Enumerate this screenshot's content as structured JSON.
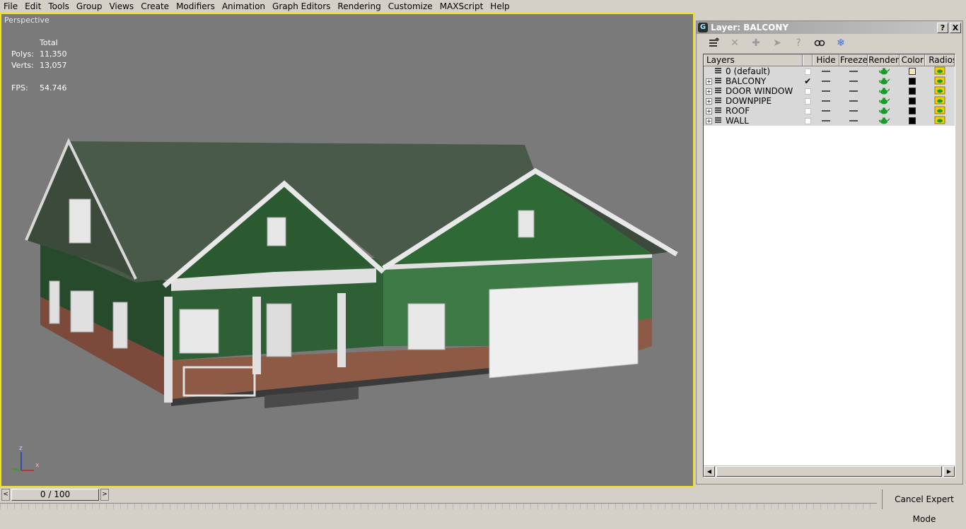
{
  "menu": [
    "File",
    "Edit",
    "Tools",
    "Group",
    "Views",
    "Create",
    "Modifiers",
    "Animation",
    "Graph Editors",
    "Rendering",
    "Customize",
    "MAXScript",
    "Help"
  ],
  "viewport": {
    "label": "Perspective",
    "stats": {
      "total_label": "Total",
      "polys_label": "Polys:",
      "polys_value": "11,350",
      "verts_label": "Verts:",
      "verts_value": "13,057",
      "fps_label": "FPS:",
      "fps_value": "54.746"
    },
    "axis": {
      "z": "z",
      "x": "x"
    }
  },
  "layer_dialog": {
    "title": "Layer: BALCONY",
    "help_btn": "?",
    "close_btn": "X",
    "toolbar_icons": [
      "new-layer-icon",
      "delete-icon",
      "add-selection-icon",
      "select-objects-icon",
      "highlight-icon",
      "hide-all-icon",
      "freeze-all-icon"
    ],
    "columns": [
      "Layers",
      "Hide",
      "Freeze",
      "Render",
      "Color",
      "Radios"
    ],
    "layers": [
      {
        "name": "0 (default)",
        "expandable": false,
        "current": false,
        "color": "#f2e6c0"
      },
      {
        "name": "BALCONY",
        "expandable": true,
        "current": true,
        "color": "#000000"
      },
      {
        "name": "DOOR WINDOW",
        "expandable": true,
        "current": false,
        "color": "#000000"
      },
      {
        "name": "DOWNPIPE",
        "expandable": true,
        "current": false,
        "color": "#000000"
      },
      {
        "name": "ROOF",
        "expandable": true,
        "current": false,
        "color": "#000000"
      },
      {
        "name": "WALL",
        "expandable": true,
        "current": false,
        "color": "#000000"
      }
    ]
  },
  "timebar": {
    "frame": "0 / 100",
    "prev": "<",
    "next": ">",
    "cancel_expert": "Cancel Expert Mode"
  }
}
